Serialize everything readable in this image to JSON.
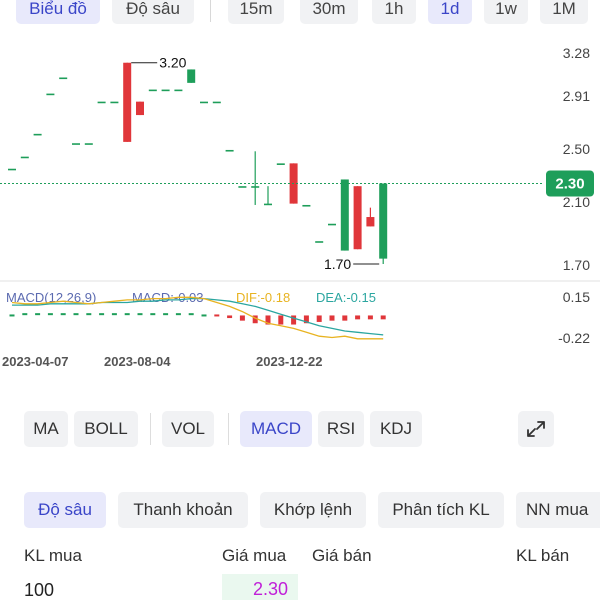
{
  "top_tabs": [
    {
      "label": "Biểu đồ",
      "active": true
    },
    {
      "label": "Độ sâu",
      "active": false
    },
    {
      "label": "15m",
      "active": false
    },
    {
      "label": "30m",
      "active": false
    },
    {
      "label": "1h",
      "active": false
    },
    {
      "label": "1d",
      "active": true
    },
    {
      "label": "1w",
      "active": false
    },
    {
      "label": "1M",
      "active": false
    }
  ],
  "colors": {
    "up": "#1e9e5a",
    "down": "#e0363a",
    "accent": "#3a45c8",
    "dif": "#e8b321",
    "dea": "#2ba6a0",
    "macd_label": "#5b6ab0",
    "last_price": "#1e9e5a",
    "bid_price": "#c020d8"
  },
  "chart_data": {
    "type": "candlestick",
    "price_axis_ticks": [
      "3.28",
      "2.91",
      "2.50",
      "2.10",
      "1.70"
    ],
    "price_ylim": [
      1.7,
      3.28
    ],
    "last_price": "2.30",
    "last_price_value": 2.3,
    "max_label": "3.20",
    "max_value": 3.2,
    "min_label": "1.70",
    "min_value": 1.7,
    "candles": [
      {
        "o": 2.41,
        "h": 2.41,
        "l": 2.41,
        "c": 2.41
      },
      {
        "o": 2.5,
        "h": 2.5,
        "l": 2.5,
        "c": 2.5
      },
      {
        "o": 2.67,
        "h": 2.67,
        "l": 2.67,
        "c": 2.67
      },
      {
        "o": 2.97,
        "h": 2.97,
        "l": 2.97,
        "c": 2.97
      },
      {
        "o": 3.09,
        "h": 3.09,
        "l": 3.09,
        "c": 3.09
      },
      {
        "o": 2.6,
        "h": 2.6,
        "l": 2.6,
        "c": 2.6
      },
      {
        "o": 2.6,
        "h": 2.6,
        "l": 2.6,
        "c": 2.6
      },
      {
        "o": 2.91,
        "h": 2.91,
        "l": 2.91,
        "c": 2.91
      },
      {
        "o": 2.91,
        "h": 2.91,
        "l": 2.91,
        "c": 2.91
      },
      {
        "o": 3.2,
        "h": 3.2,
        "l": 2.61,
        "c": 2.61
      },
      {
        "o": 2.91,
        "h": 2.91,
        "l": 2.81,
        "c": 2.81
      },
      {
        "o": 3.0,
        "h": 3.0,
        "l": 3.0,
        "c": 3.0
      },
      {
        "o": 3.0,
        "h": 3.0,
        "l": 3.0,
        "c": 3.0
      },
      {
        "o": 3.0,
        "h": 3.0,
        "l": 3.0,
        "c": 3.0
      },
      {
        "o": 3.05,
        "h": 3.15,
        "l": 3.05,
        "c": 3.15
      },
      {
        "o": 2.91,
        "h": 2.91,
        "l": 2.91,
        "c": 2.91
      },
      {
        "o": 2.91,
        "h": 2.91,
        "l": 2.91,
        "c": 2.91
      },
      {
        "o": 2.55,
        "h": 2.55,
        "l": 2.55,
        "c": 2.55
      },
      {
        "o": 2.28,
        "h": 2.28,
        "l": 2.28,
        "c": 2.28
      },
      {
        "o": 2.28,
        "h": 2.54,
        "l": 2.14,
        "c": 2.28
      },
      {
        "o": 2.15,
        "h": 2.28,
        "l": 2.14,
        "c": 2.15
      },
      {
        "o": 2.45,
        "h": 2.45,
        "l": 2.45,
        "c": 2.45
      },
      {
        "o": 2.45,
        "h": 2.45,
        "l": 2.15,
        "c": 2.15
      },
      {
        "o": 2.14,
        "h": 2.14,
        "l": 2.14,
        "c": 2.14
      },
      {
        "o": 1.87,
        "h": 1.87,
        "l": 1.87,
        "c": 1.87
      },
      {
        "o": 2.0,
        "h": 2.0,
        "l": 2.0,
        "c": 2.0
      },
      {
        "o": 1.8,
        "h": 2.33,
        "l": 1.8,
        "c": 2.33
      },
      {
        "o": 2.28,
        "h": 2.28,
        "l": 1.81,
        "c": 1.81
      },
      {
        "o": 2.05,
        "h": 2.12,
        "l": 1.98,
        "c": 1.98
      },
      {
        "o": 1.74,
        "h": 2.3,
        "l": 1.7,
        "c": 2.3
      }
    ],
    "macd_panel": {
      "title": "MACD(12,26,9)",
      "macd_label": "MACD:-0.03",
      "dif_label": "DIF:-0.18",
      "dea_label": "DEA:-0.15",
      "axis_ticks": [
        "0.15",
        "-0.22"
      ],
      "ylim": [
        -0.22,
        0.15
      ],
      "histogram": [
        0.0,
        0.01,
        0.01,
        0.01,
        0.01,
        0.01,
        0.01,
        0.01,
        0.01,
        0.01,
        0.01,
        0.01,
        0.01,
        0.01,
        0.01,
        0.0,
        -0.01,
        -0.02,
        -0.04,
        -0.06,
        -0.07,
        -0.07,
        -0.07,
        -0.06,
        -0.05,
        -0.04,
        -0.04,
        -0.03,
        -0.03,
        -0.03
      ],
      "dif": [
        0.1,
        0.09,
        0.09,
        0.1,
        0.11,
        0.1,
        0.09,
        0.1,
        0.11,
        0.12,
        0.12,
        0.13,
        0.13,
        0.14,
        0.14,
        0.13,
        0.1,
        0.07,
        0.03,
        -0.02,
        -0.06,
        -0.08,
        -0.1,
        -0.13,
        -0.16,
        -0.17,
        -0.16,
        -0.18,
        -0.18,
        -0.18
      ],
      "dea": [
        0.08,
        0.08,
        0.08,
        0.09,
        0.09,
        0.09,
        0.09,
        0.1,
        0.1,
        0.1,
        0.11,
        0.11,
        0.12,
        0.12,
        0.13,
        0.13,
        0.12,
        0.11,
        0.09,
        0.07,
        0.04,
        0.01,
        -0.02,
        -0.05,
        -0.08,
        -0.1,
        -0.12,
        -0.13,
        -0.14,
        -0.15
      ]
    },
    "date_labels": [
      {
        "label": "2023-04-07",
        "index": 3
      },
      {
        "label": "2023-08-04",
        "index": 12
      },
      {
        "label": "2023-12-22",
        "index": 23
      }
    ]
  },
  "indicators": [
    {
      "label": "MA",
      "active": false
    },
    {
      "label": "BOLL",
      "active": false
    },
    {
      "label": "VOL",
      "active": false
    },
    {
      "label": "MACD",
      "active": true
    },
    {
      "label": "RSI",
      "active": false
    },
    {
      "label": "KDJ",
      "active": false
    }
  ],
  "expand_icon": "expand-icon",
  "bottom_tabs": [
    {
      "label": "Độ sâu",
      "active": true
    },
    {
      "label": "Thanh khoản",
      "active": false
    },
    {
      "label": "Khớp lệnh",
      "active": false
    },
    {
      "label": "Phân tích KL",
      "active": false
    },
    {
      "label": "NN mua",
      "active": false
    }
  ],
  "order_book": {
    "headers": {
      "bid_vol": "KL mua",
      "bid_price": "Giá mua",
      "ask_price": "Giá bán",
      "ask_vol": "KL bán"
    },
    "rows": [
      {
        "bid_vol": "100",
        "bid_price": "2.30"
      }
    ]
  }
}
